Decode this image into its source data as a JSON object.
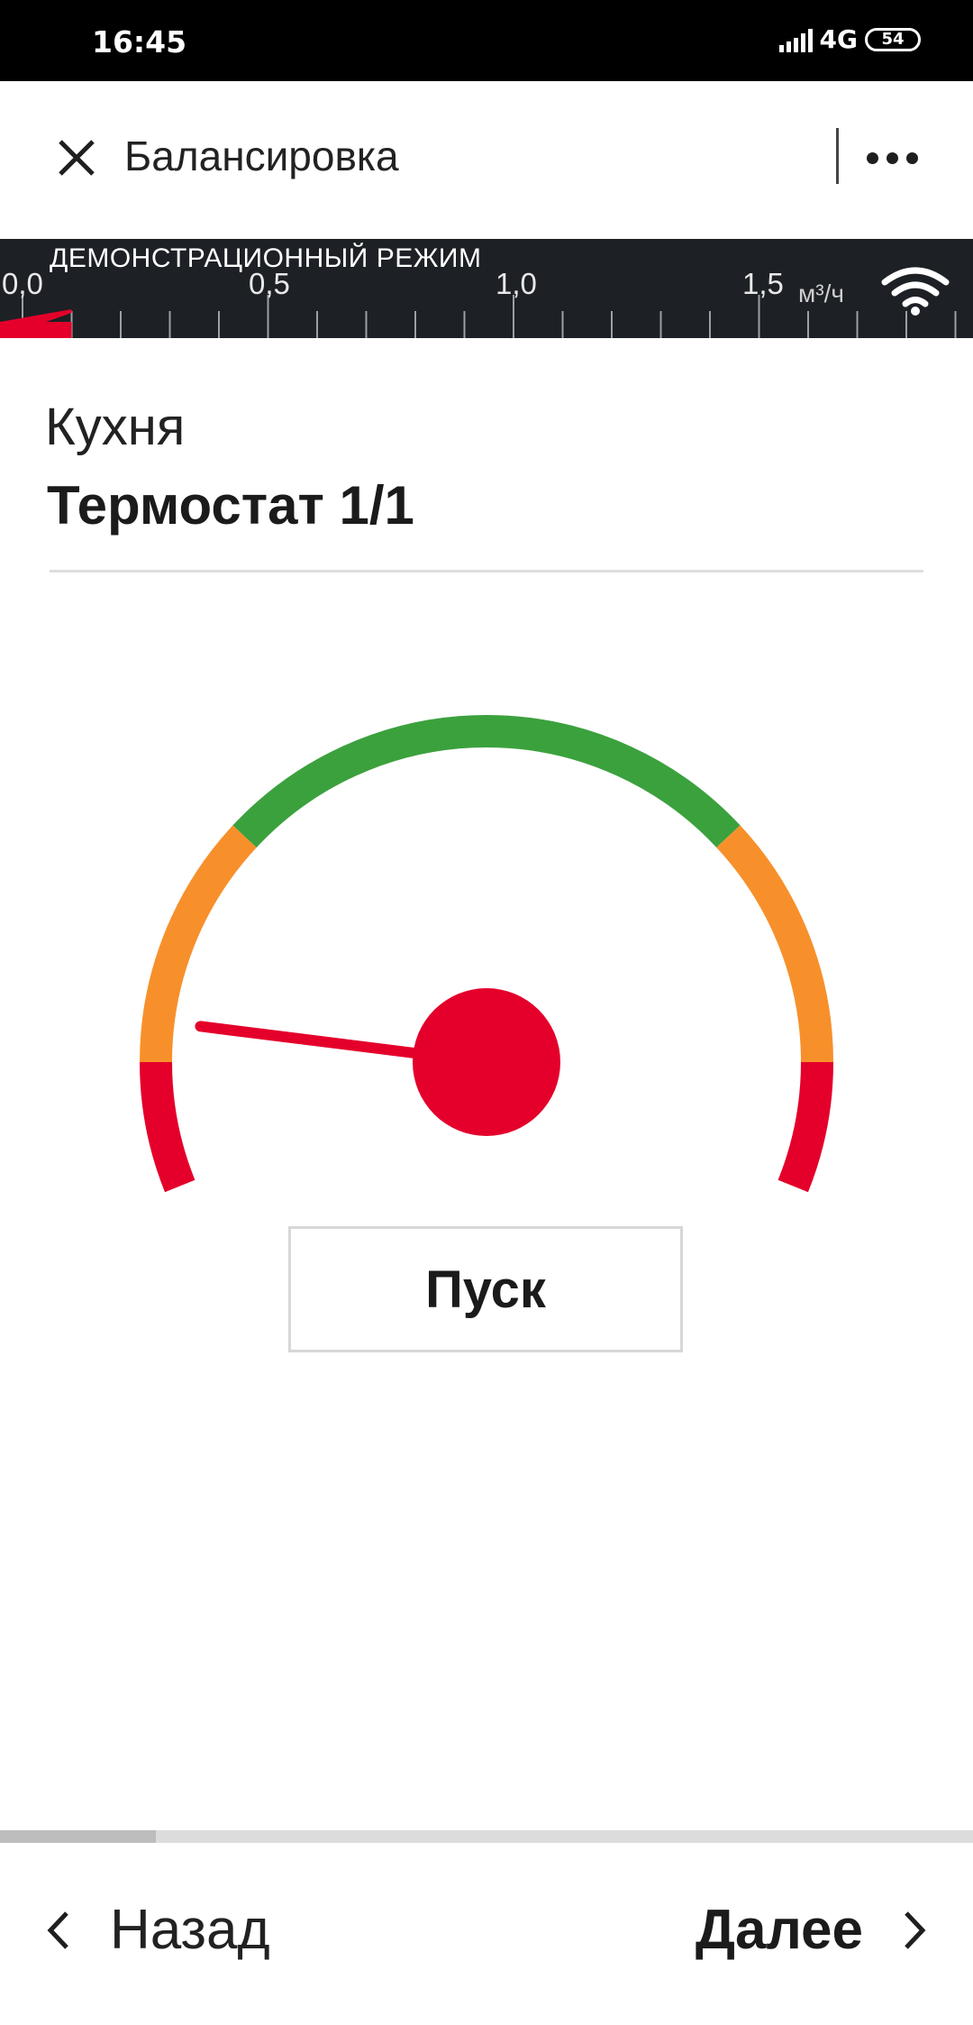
{
  "status": {
    "time": "16:45",
    "network": "4G",
    "battery": "54"
  },
  "appbar": {
    "title": "Балансировка",
    "close_icon": "close-icon",
    "more_icon": "more-dots-icon"
  },
  "meter": {
    "mode_label": "ДЕМОНСТРАЦИОННЫЙ РЕЖИМ",
    "ticks": [
      "0,0",
      "0,5",
      "1,0",
      "1,5"
    ],
    "unit": "м³/ч",
    "flow_fraction": 0.05,
    "accent": "#e4002b",
    "wifi_icon": "wifi-icon"
  },
  "content": {
    "room": "Кухня",
    "device": "Термостат 1/1"
  },
  "gauge": {
    "colors": {
      "red": "#e4002b",
      "orange": "#f7902b",
      "green": "#3ba13d"
    },
    "needle_level": 0.13
  },
  "start_button": {
    "label": "Пуск"
  },
  "progress": {
    "fraction": 0.16
  },
  "nav": {
    "back_label": "Назад",
    "next_label": "Далее"
  }
}
